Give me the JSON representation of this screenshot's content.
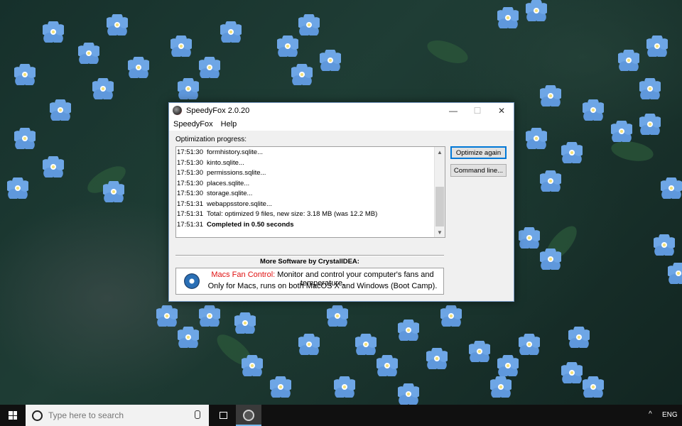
{
  "window": {
    "title": "SpeedyFox 2.0.20",
    "controls": {
      "minimize": "—",
      "maximize": "☐",
      "close": "✕"
    },
    "menu": [
      "SpeedyFox",
      "Help"
    ]
  },
  "progress": {
    "label": "Optimization progress:",
    "log": [
      {
        "time": "17:51:30",
        "text": "formhistory.sqlite...",
        "bold": false
      },
      {
        "time": "17:51:30",
        "text": "kinto.sqlite...",
        "bold": false
      },
      {
        "time": "17:51:30",
        "text": "permissions.sqlite...",
        "bold": false
      },
      {
        "time": "17:51:30",
        "text": "places.sqlite...",
        "bold": false
      },
      {
        "time": "17:51:30",
        "text": "storage.sqlite...",
        "bold": false
      },
      {
        "time": "17:51:31",
        "text": "webappsstore.sqlite...",
        "bold": false
      },
      {
        "time": "17:51:31",
        "text": "Total: optimized 9 files, new size: 3.18 MB (was 12.2 MB)",
        "bold": false
      },
      {
        "time": "17:51:31",
        "text": "Completed in 0.50 seconds",
        "bold": true
      }
    ]
  },
  "buttons": {
    "optimize_again": "Optimize again",
    "command_line": "Command line..."
  },
  "more_software": {
    "title": "More Software by CrystalIDEA:",
    "ad_brand": "Macs Fan Control:",
    "ad_line1": " Monitor and control your computer's fans and temperature.",
    "ad_line2": "Only for Macs, runs on both MacOS X and Windows (Boot Camp)."
  },
  "taskbar": {
    "search_placeholder": "Type here to search",
    "language": "ENG",
    "tray_chevron": "^"
  }
}
